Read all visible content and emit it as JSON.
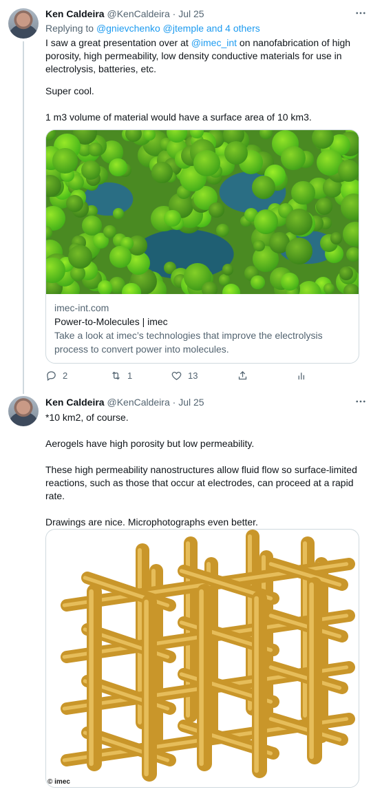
{
  "tweets": [
    {
      "author": {
        "name": "Ken Caldeira",
        "handle": "@KenCaldeira",
        "separator": "·",
        "date": "Jul 25"
      },
      "replying": {
        "prefix": "Replying to ",
        "users": "@gnievchenko @jtemple",
        "suffix": "and 4 others"
      },
      "text": {
        "line1_pre": "I saw a great presentation over at ",
        "line1_mention": "@imec_int",
        "line1_post": " on nanofabrication of high porosity, high permeability, low density conductive materials for use in electrolysis, batteries, etc.",
        "para2": "Super cool.",
        "para3": "1 m3 volume of material would have a surface area of 10 km3."
      },
      "card": {
        "domain": "imec-int.com",
        "title": "Power-to-Molecules | imec",
        "description": "Take a look at imec’s technologies that improve the electrolysis process to convert power into molecules."
      },
      "actions": {
        "reply": "2",
        "retweet": "1",
        "like": "13",
        "share": "",
        "analytics": ""
      },
      "more_icon": "more-horizontal-icon"
    },
    {
      "author": {
        "name": "Ken Caldeira",
        "handle": "@KenCaldeira",
        "separator": "·",
        "date": "Jul 25"
      },
      "text": "*10 km2, of course.\n\nAerogels have high porosity but low permeability.\n\nThese high permeability nanostructures allow fluid flow so surface-limited reactions, such as those that occur at electrodes, can proceed at a rapid rate.\n\nDrawings are nice. Microphotographs even better.",
      "media": {
        "watermark": "© imec"
      },
      "more_icon": "more-horizontal-icon"
    }
  ],
  "colors": {
    "link": "#1d9bf0",
    "secondary_text": "#536471",
    "border": "#cfd9de",
    "lattice": "#c9962a"
  }
}
